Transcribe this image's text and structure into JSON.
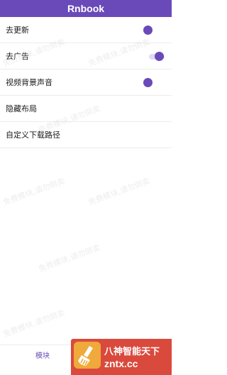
{
  "app": {
    "title": "Rnbook"
  },
  "settings": [
    {
      "label": "去更新",
      "toggle": "on"
    },
    {
      "label": "去广告",
      "toggle": "on"
    },
    {
      "label": "视频背景声音",
      "toggle": "on"
    },
    {
      "label": "隐藏布局",
      "toggle": "none"
    },
    {
      "label": "自定义下载路径",
      "toggle": "none"
    }
  ],
  "tabbar": {
    "tabs": [
      {
        "label": "模块"
      }
    ]
  },
  "watermark": {
    "text": "免费模块,请勿倒卖"
  },
  "badge": {
    "title": "八神智能天下",
    "url": "zntx.cc"
  },
  "colors": {
    "accent": "#6a4ab8",
    "header_bg": "#6a4ab8",
    "badge_bg": "#d94a3c"
  }
}
